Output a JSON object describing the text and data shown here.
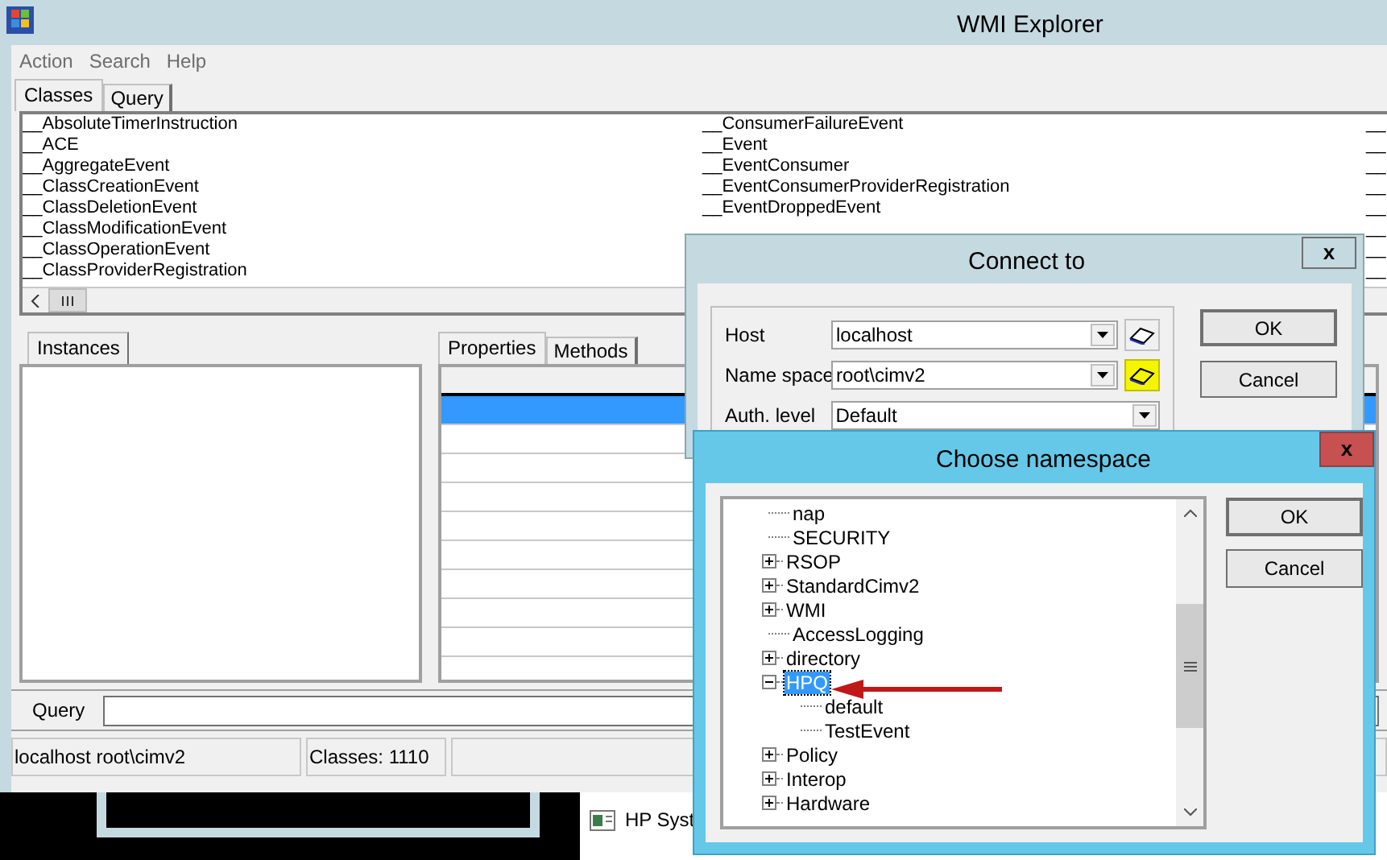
{
  "window": {
    "title": "WMI Explorer"
  },
  "menu": [
    "Action",
    "Search",
    "Help"
  ],
  "top_tabs": [
    {
      "label": "Classes",
      "selected": true
    },
    {
      "label": "Query",
      "selected": false
    }
  ],
  "classes": {
    "column_1": [
      "__AbsoluteTimerInstruction",
      "__ACE",
      "__AggregateEvent",
      "__ClassCreationEvent",
      "__ClassDeletionEvent",
      "__ClassModificationEvent",
      "__ClassOperationEvent",
      "__ClassProviderRegistration"
    ],
    "column_2": [
      "__ConsumerFailureEvent",
      "__Event",
      "__EventConsumer",
      "__EventConsumerProviderRegistration",
      "__EventDroppedEvent"
    ],
    "column_3": [
      "__",
      "__",
      "__",
      "__",
      "__",
      "__",
      "__",
      "__"
    ]
  },
  "instances_tab": {
    "label": "Instances",
    "selected": true
  },
  "detail_tabs": [
    {
      "label": "Properties",
      "selected": true
    },
    {
      "label": "Methods",
      "selected": false
    }
  ],
  "properties_rows": [
    {
      "selected": true
    },
    {
      "selected": false
    },
    {
      "selected": false
    },
    {
      "selected": false
    },
    {
      "selected": false
    },
    {
      "selected": false
    },
    {
      "selected": false
    },
    {
      "selected": false
    },
    {
      "selected": false
    }
  ],
  "query": {
    "label": "Query"
  },
  "status_bar": [
    "localhost  root\\cimv2",
    "Classes: 1110"
  ],
  "background_item": {
    "label": "HP Syst"
  },
  "connect_dialog": {
    "title": "Connect to",
    "close": "x",
    "fields": [
      {
        "label": "Host",
        "value": "localhost",
        "browse": true,
        "highlighted": false
      },
      {
        "label": "Name space",
        "value": "root\\cimv2",
        "browse": true,
        "highlighted": true
      },
      {
        "label": "Auth. level",
        "value": "Default",
        "browse": false
      }
    ],
    "buttons": [
      "OK",
      "Cancel"
    ]
  },
  "namespace_dialog": {
    "title": "Choose namespace",
    "close": "x",
    "tree": [
      {
        "label": "nap",
        "kind": "leaf",
        "selected": false
      },
      {
        "label": "SECURITY",
        "kind": "leaf",
        "selected": false
      },
      {
        "label": "RSOP",
        "kind": "branch",
        "expanded": false,
        "selected": false
      },
      {
        "label": "StandardCimv2",
        "kind": "branch",
        "expanded": false,
        "selected": false
      },
      {
        "label": "WMI",
        "kind": "branch",
        "expanded": false,
        "selected": false
      },
      {
        "label": "AccessLogging",
        "kind": "leaf",
        "selected": false
      },
      {
        "label": "directory",
        "kind": "branch",
        "expanded": false,
        "selected": false
      },
      {
        "label": "HPQ",
        "kind": "branch",
        "expanded": true,
        "selected": true,
        "children": [
          {
            "label": "default",
            "kind": "leaf",
            "selected": false
          },
          {
            "label": "TestEvent",
            "kind": "leaf",
            "selected": false
          }
        ]
      },
      {
        "label": "Policy",
        "kind": "branch",
        "expanded": false,
        "selected": false
      },
      {
        "label": "Interop",
        "kind": "branch",
        "expanded": false,
        "selected": false
      },
      {
        "label": "Hardware",
        "kind": "branch",
        "expanded": false,
        "selected": false
      }
    ],
    "buttons": [
      "OK",
      "Cancel"
    ]
  }
}
